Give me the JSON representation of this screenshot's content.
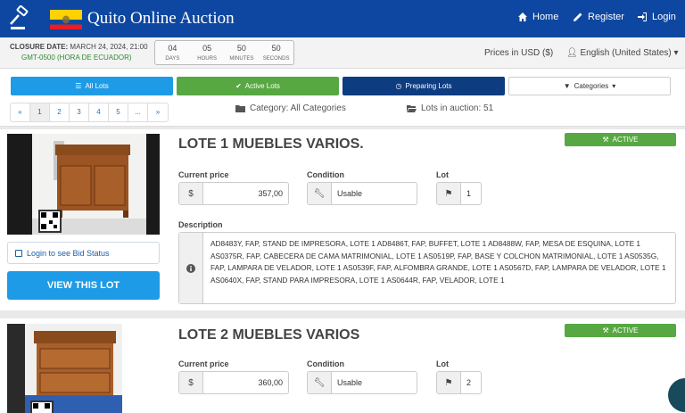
{
  "header": {
    "brand": "Quito Online Auction",
    "nav": [
      {
        "label": "Home",
        "icon": "home-icon"
      },
      {
        "label": "Register",
        "icon": "pencil-icon"
      },
      {
        "label": "Login",
        "icon": "login-icon"
      }
    ],
    "colors": {
      "header_bg": "#0d47a1"
    }
  },
  "closure": {
    "label": "CLOSURE DATE:",
    "date": "MARCH 24, 2024, 21:00",
    "timezone": "GMT-0500 (HORA DE ECUADOR)",
    "countdown": [
      {
        "value": "04",
        "unit": "DAYS"
      },
      {
        "value": "05",
        "unit": "HOURS"
      },
      {
        "value": "50",
        "unit": "MINUTES"
      },
      {
        "value": "50",
        "unit": "SECONDS"
      }
    ]
  },
  "prices_label": "Prices in USD ($)",
  "language": "English (United States)",
  "filters": [
    {
      "label": "All Lots",
      "color": "#1e9be6"
    },
    {
      "label": "Active Lots",
      "color": "#57a842"
    },
    {
      "label": "Preparing Lots",
      "color": "#0d47a1"
    },
    {
      "label": "Categories",
      "color": "#ffffff"
    }
  ],
  "pagination": [
    "«",
    "1",
    "2",
    "3",
    "4",
    "5",
    "...",
    "»"
  ],
  "category_info": "Category: All Categories",
  "lots_info": "Lots in auction: 51",
  "labels": {
    "current_price": "Current price",
    "condition": "Condition",
    "lot": "Lot",
    "description": "Description",
    "bid_status": "Login to see Bid Status",
    "view_lot": "VIEW THIS LOT",
    "currency": "$",
    "qr_code": "AD8483Y"
  },
  "lots": [
    {
      "title": "LOTE 1 MUEBLES VARIOS.",
      "status": "ACTIVE",
      "price": "357,00",
      "condition": "Usable",
      "lot_number": "1",
      "description": "AD8483Y, FAP, STAND DE IMPRESORA, LOTE 1 AD8486T, FAP, BUFFET, LOTE 1 AD8488W, FAP, MESA DE ESQUINA, LOTE 1 AS0375R, FAP, CABECERA DE CAMA MATRIMONIAL, LOTE 1 AS0519P, FAP, BASE Y COLCHON MATRIMONIAL, LOTE 1 AS0535G, FAP, LAMPARA DE VELADOR, LOTE 1 AS0539F, FAP, ALFOMBRA GRANDE, LOTE 1 AS0567D, FAP, LAMPARA DE VELADOR, LOTE 1 AS0640X, FAP, STAND PARA IMPRESORA, LOTE 1 AS0644R, FAP, VELADOR, LOTE 1"
    },
    {
      "title": "LOTE 2 MUEBLES VARIOS",
      "status": "ACTIVE",
      "price": "360,00",
      "condition": "Usable",
      "lot_number": "2",
      "description": ""
    }
  ]
}
